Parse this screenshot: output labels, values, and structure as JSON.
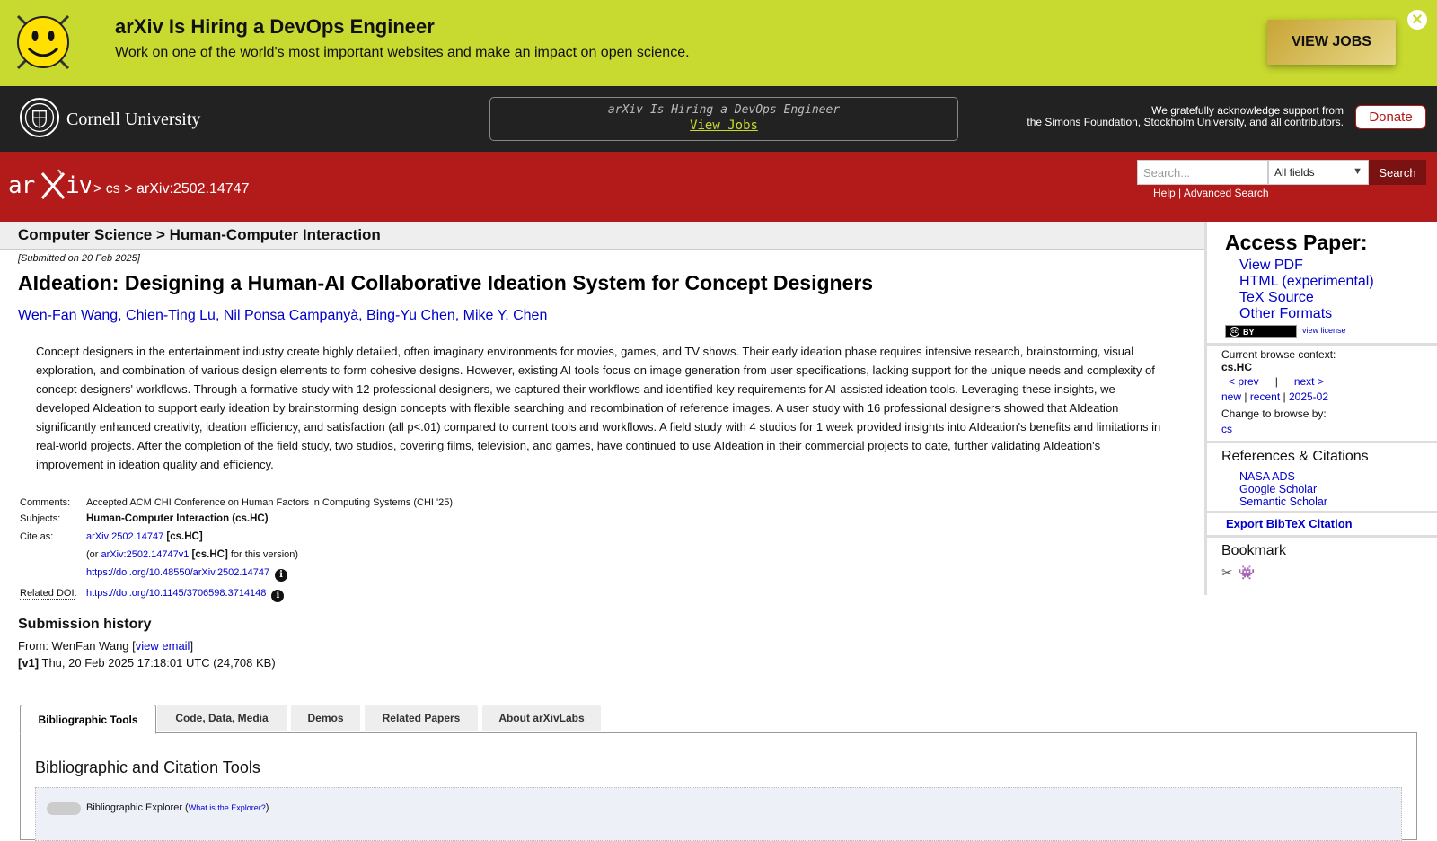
{
  "hiring_banner": {
    "title": "arXiv Is Hiring a DevOps Engineer",
    "subtitle": "Work on one of the world's most important websites and make an impact on open science.",
    "button": "VIEW JOBS",
    "close_icon": "close-circle-icon"
  },
  "cornell_bar": {
    "name": "Cornell University",
    "notice_title": "arXiv Is Hiring a DevOps Engineer",
    "notice_link": "View Jobs",
    "ack_line1": "We gratefully acknowledge support from",
    "ack_line2_pre": "the Simons Foundation, ",
    "ack_link": "Stockholm University",
    "ack_line2_post": ", and all contributors.",
    "donate": "Donate"
  },
  "header": {
    "logo": "arXiv",
    "breadcrumb": [
      " > ",
      "cs",
      " > ",
      "arXiv:2502.14747"
    ],
    "search_placeholder": "Search...",
    "search_field": "All fields",
    "search_button": "Search",
    "help": "Help",
    "separator": " | ",
    "advanced": "Advanced Search"
  },
  "subject_bar": "Computer Science > Human-Computer Interaction",
  "paper": {
    "submitted": "[Submitted on 20 Feb 2025]",
    "title": "AIdeation: Designing a Human-AI Collaborative Ideation System for Concept Designers",
    "authors": [
      "Wen-Fan Wang",
      "Chien-Ting Lu",
      "Nil Ponsa Campanyà",
      "Bing-Yu Chen",
      "Mike Y. Chen"
    ],
    "abstract": "Concept designers in the entertainment industry create highly detailed, often imaginary environments for movies, games, and TV shows. Their early ideation phase requires intensive research, brainstorming, visual exploration, and combination of various design elements to form cohesive designs. However, existing AI tools focus on image generation from user specifications, lacking support for the unique needs and complexity of concept designers' workflows. Through a formative study with 12 professional designers, we captured their workflows and identified key requirements for AI-assisted ideation tools. Leveraging these insights, we developed AIdeation to support early ideation by brainstorming design concepts with flexible searching and recombination of reference images. A user study with 16 professional designers showed that AIdeation significantly enhanced creativity, ideation efficiency, and satisfaction (all p<.01) compared to current tools and workflows. A field study with 4 studios for 1 week provided insights into AIdeation's benefits and limitations in real-world projects. After the completion of the field study, two studios, covering films, television, and games, have continued to use AIdeation in their commercial projects to date, further validating AIdeation's improvement in ideation quality and efficiency."
  },
  "meta": {
    "comments_label": "Comments:",
    "comments": "Accepted ACM CHI Conference on Human Factors in Computing Systems (CHI '25)",
    "subjects_label": "Subjects:",
    "subjects": "Human-Computer Interaction (cs.HC)",
    "cite_label": "Cite as:",
    "cite_id": "arXiv:2502.14747",
    "cite_tag": " [cs.HC]",
    "cite_v_pre": "(or ",
    "cite_v_id": "arXiv:2502.14747v1",
    "cite_v_tag": " [cs.HC]",
    "cite_v_post": " for this version)",
    "doi": "https://doi.org/10.48550/arXiv.2502.14747",
    "related_doi_label": "Related DOI",
    "related_doi_colon": ":",
    "related_doi": "https://doi.org/10.1145/3706598.3714148",
    "info_icon": "info-icon"
  },
  "submission_history": {
    "title": "Submission history",
    "from_pre": "From: WenFan Wang [",
    "view_email": "view email",
    "from_post": "]",
    "v1_tag": "[v1]",
    "v1_text": " Thu, 20 Feb 2025 17:18:01 UTC (24,708 KB)"
  },
  "tabs": [
    "Bibliographic Tools",
    "Code, Data, Media",
    "Demos",
    "Related Papers",
    "About arXivLabs"
  ],
  "tab_panel": {
    "title": "Bibliographic and Citation Tools",
    "explorer_label": "Bibliographic Explorer (",
    "explorer_link": "What is the Explorer?",
    "explorer_post": ")"
  },
  "sidebar": {
    "access_title": "Access Paper:",
    "access_links": [
      "View PDF",
      "HTML (experimental)",
      "TeX Source",
      "Other Formats"
    ],
    "license_badge": "BY",
    "view_license": "view license",
    "context_label": "Current browse context:",
    "context_value": "cs.HC",
    "prev": "< prev",
    "nav_sep": "|",
    "next": "next >",
    "new": "new",
    "recent": "recent",
    "date": "2025-02",
    "change_label": "Change to browse by:",
    "change_value": "cs",
    "refs_title": "References & Citations",
    "refs_links": [
      "NASA ADS",
      "Google Scholar",
      "Semantic Scholar"
    ],
    "bibtex": "Export BibTeX Citation",
    "bookmark_title": "Bookmark",
    "bookmark_icons": [
      "bibsonomy-icon",
      "reddit-icon"
    ]
  },
  "colors": {
    "arxiv_red": "#b31b1b",
    "banner_green": "#c8d92f",
    "cornell_dark": "#222222",
    "link_blue": "#0000cc"
  }
}
